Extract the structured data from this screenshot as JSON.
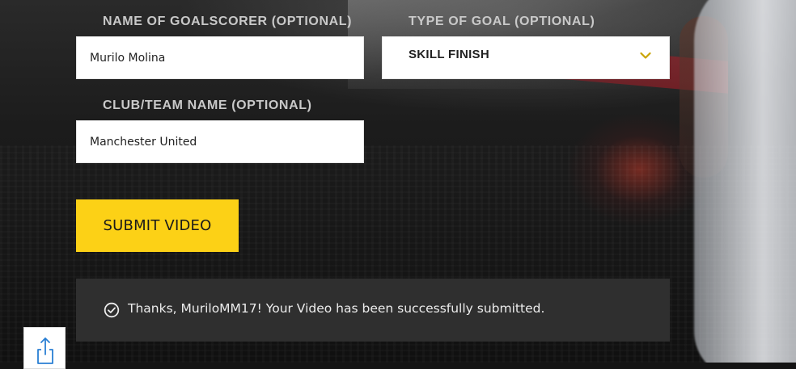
{
  "form": {
    "goalscorer": {
      "label": "NAME OF GOALSCORER (OPTIONAL)",
      "value": "Murilo Molina"
    },
    "goal_type": {
      "label": "TYPE OF GOAL (OPTIONAL)",
      "selected": "SKILL FINISH",
      "icon": "chevron-down-icon",
      "icon_color": "#c9a400"
    },
    "club": {
      "label": "CLUB/TEAM NAME (OPTIONAL)",
      "value": "Manchester United"
    },
    "submit": {
      "label": "SUBMIT VIDEO",
      "color": "#fcd116"
    }
  },
  "notice": {
    "icon": "check-circle-icon",
    "text": "Thanks, MuriloMM17! Your Video has been successfully submitted."
  },
  "share": {
    "icon": "share-icon",
    "icon_color": "#2a7fd4"
  }
}
